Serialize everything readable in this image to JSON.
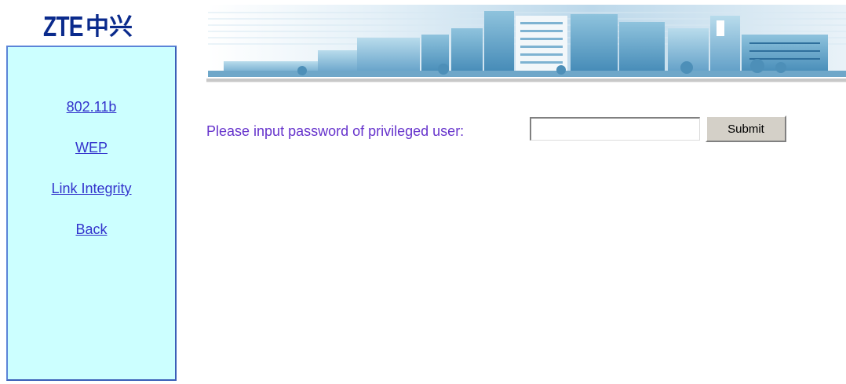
{
  "logo": {
    "latin": "ZTE",
    "cjk": "中兴",
    "color": "#0a2a8c"
  },
  "sidebar": {
    "background": "#ccffff",
    "items": [
      {
        "label": "802.11b"
      },
      {
        "label": "WEP"
      },
      {
        "label": "Link Integrity"
      },
      {
        "label": "Back"
      }
    ]
  },
  "banner": {
    "icon": "office-buildings-banner"
  },
  "form": {
    "prompt": "Please input password of privileged user:",
    "password_value": "",
    "submit_label": "Submit"
  },
  "colors": {
    "link": "#3333cc",
    "prompt": "#6633cc"
  }
}
